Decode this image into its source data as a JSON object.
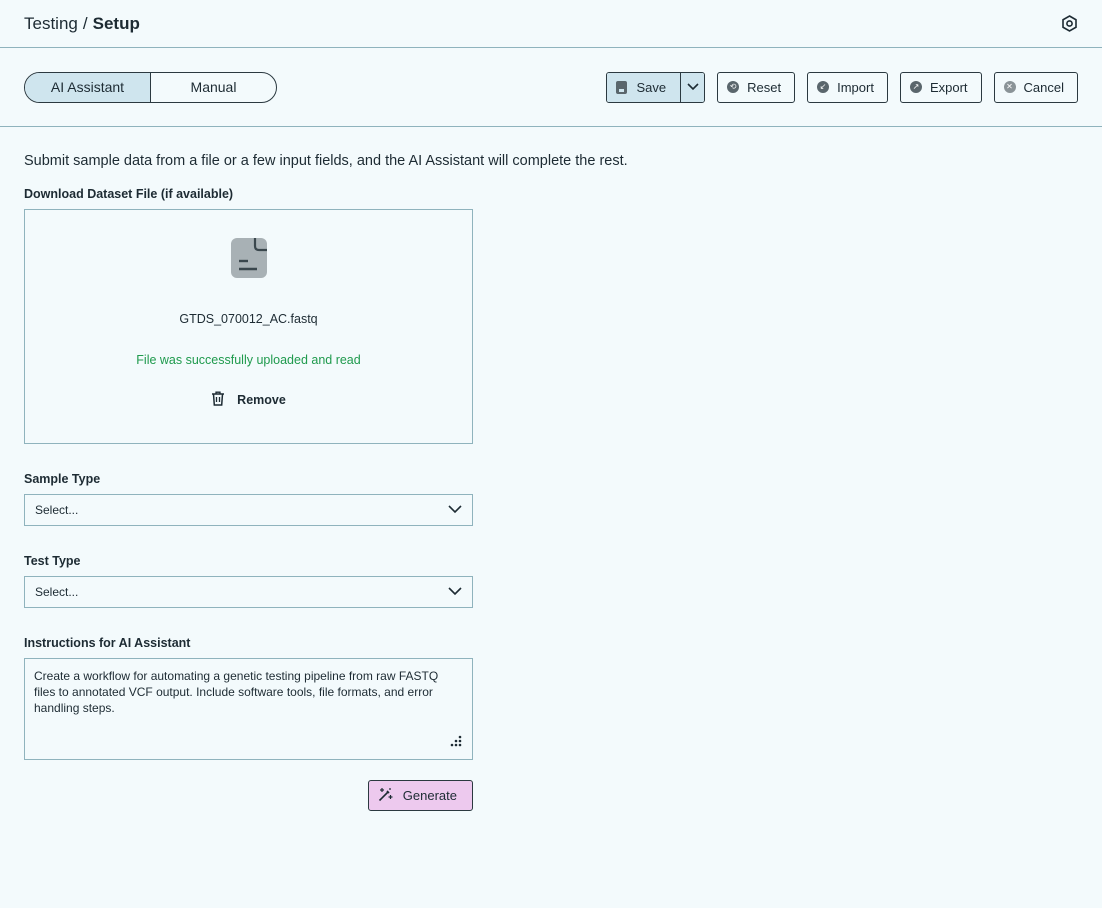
{
  "breadcrumb": {
    "parent": "Testing",
    "separator": "/",
    "current": "Setup"
  },
  "mode_toggle": {
    "options": [
      "AI Assistant",
      "Manual"
    ],
    "selected": "AI Assistant"
  },
  "toolbar": {
    "save_label": "Save",
    "reset_label": "Reset",
    "import_label": "Import",
    "export_label": "Export",
    "cancel_label": "Cancel"
  },
  "intro_text": "Submit sample data from a file or a few input fields, and the AI Assistant will complete the rest.",
  "upload": {
    "label": "Download Dataset File (if available)",
    "file_name": "GTDS_070012_AC.fastq",
    "status": "File was successfully uploaded and read",
    "remove_label": "Remove"
  },
  "sample_type": {
    "label": "Sample Type",
    "value": "Select..."
  },
  "test_type": {
    "label": "Test Type",
    "value": "Select..."
  },
  "instructions": {
    "label": "Instructions for AI Assistant",
    "value": "Create a workflow for automating a genetic testing pipeline from raw FASTQ files to annotated VCF output. Include software tools, file formats, and error handling steps."
  },
  "generate_label": "Generate",
  "colors": {
    "background": "#f3fafc",
    "accent_selected": "#cfe5ee",
    "success": "#1f9a4d",
    "generate_bg": "#edc9ee",
    "border": "#8fb3bd"
  }
}
